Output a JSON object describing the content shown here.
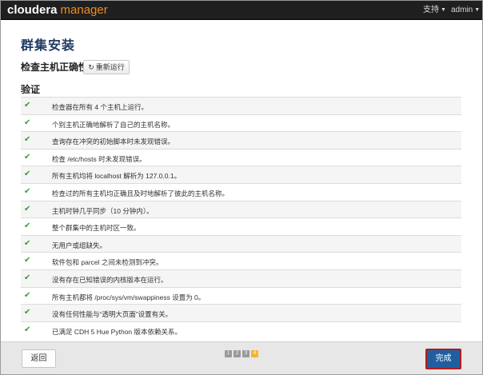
{
  "header": {
    "brand_main": "cloudera",
    "brand_sub": "manager",
    "support_label": "支持",
    "user_label": "admin"
  },
  "page": {
    "title": "群集安装",
    "section_title": "检查主机正确性",
    "rerun_label": "重新运行",
    "verify_title": "验证"
  },
  "checks": [
    "检查器在所有 4 个主机上运行。",
    "个别主机正确地解析了自己的主机名称。",
    "查询存在冲突的初始脚本时未发现错误。",
    "检查 /etc/hosts 时未发现错误。",
    "所有主机均将 localhost 解析为 127.0.0.1。",
    "检查过的所有主机均正确且及时地解析了彼此的主机名称。",
    "主机时钟几乎同步（10 分钟内）。",
    "整个群集中的主机时区一致。",
    "无用户或组缺失。",
    "软件包和 parcel 之间未检测到冲突。",
    "没有存在已知错误的内核版本在运行。",
    "所有主机都将 /proc/sys/vm/swappiness 设置为 0。",
    "没有任何性能与“透明大页面”设置有关。",
    "已满足 CDH 5 Hue Python 版本依赖关系。"
  ],
  "footer": {
    "back_label": "返回",
    "finish_label": "完成",
    "steps": [
      "1",
      "2",
      "3",
      "4"
    ]
  }
}
